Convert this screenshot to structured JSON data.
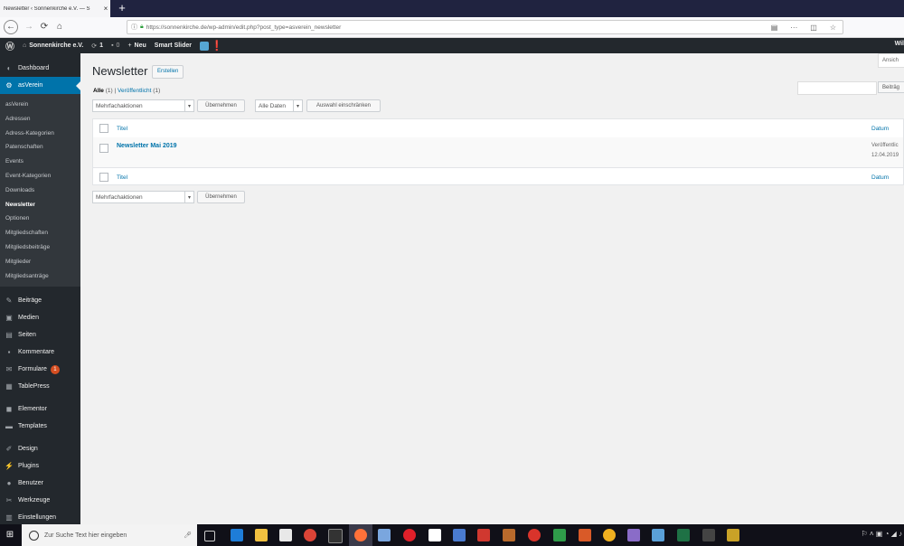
{
  "browser": {
    "tab_title": "Newsletter ‹ Sonnenkirche e.V. — S",
    "new_tab": "+",
    "url": "https://sonnenkirche.de/wp-admin/edit.php?post_type=asverein_newsletter"
  },
  "adminbar": {
    "site": "Sonnenkirche e.V.",
    "updates": "1",
    "comments": "0",
    "new": "Neu",
    "smartslider": "Smart Slider",
    "right": "Wil"
  },
  "sidebar": {
    "dashboard": "Dashboard",
    "asverein": "asVerein",
    "submenu": [
      "asVerein",
      "Adressen",
      "Adress-Kategorien",
      "Patenschaften",
      "Events",
      "Event-Kategorien",
      "Downloads",
      "Newsletter",
      "Optionen",
      "Mitgliedschaften",
      "Mitgliedsbeiträge",
      "Mitglieder",
      "Mitgliedsanträge"
    ],
    "current_sub": "Newsletter",
    "items": [
      {
        "label": "Beiträge",
        "icon": "pin-icon"
      },
      {
        "label": "Medien",
        "icon": "media-icon"
      },
      {
        "label": "Seiten",
        "icon": "pages-icon"
      },
      {
        "label": "Kommentare",
        "icon": "comments-icon"
      },
      {
        "label": "Formulare",
        "icon": "forms-icon",
        "badge": "1"
      },
      {
        "label": "TablePress",
        "icon": "table-icon"
      },
      {
        "label": "Elementor",
        "icon": "elementor-icon"
      },
      {
        "label": "Templates",
        "icon": "folder-icon"
      },
      {
        "label": "Design",
        "icon": "brush-icon"
      },
      {
        "label": "Plugins",
        "icon": "plugin-icon"
      },
      {
        "label": "Benutzer",
        "icon": "user-icon"
      },
      {
        "label": "Werkzeuge",
        "icon": "wrench-icon"
      },
      {
        "label": "Einstellungen",
        "icon": "settings-icon"
      }
    ]
  },
  "main": {
    "title": "Newsletter",
    "add_new": "Erstellen",
    "screen_options": "Ansich",
    "filter_all": "Alle",
    "filter_all_count": "(1)",
    "separator": "|",
    "filter_published": "Veröffentlicht",
    "filter_published_count": "(1)",
    "search_button": "Beiträg",
    "bulk_actions": "Mehrfachaktionen",
    "apply": "Übernehmen",
    "all_dates": "Alle Daten",
    "filter_button": "Auswahl einschränken",
    "col_title": "Titel",
    "col_date": "Datum",
    "rows": [
      {
        "title": "Newsletter Mai 2019",
        "status": "Veröffentlic",
        "date": "12.04.2019"
      }
    ]
  },
  "taskbar": {
    "search_placeholder": "Zur Suche Text hier eingeben"
  }
}
